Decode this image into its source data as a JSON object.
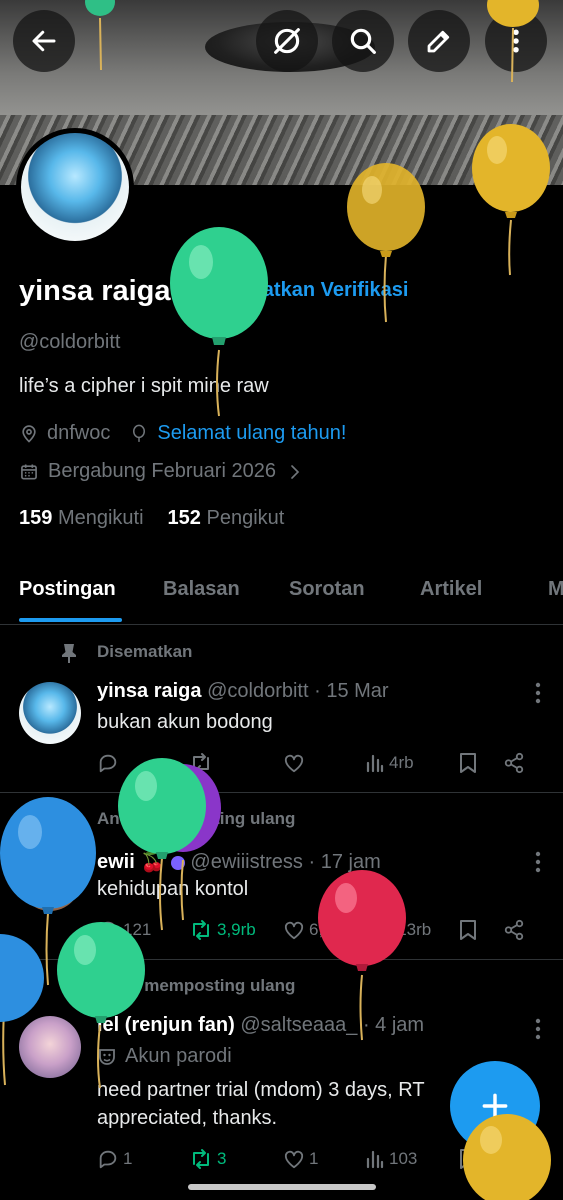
{
  "profile": {
    "name": "yinsa raiga",
    "verify_label": "Dapatkan Verifikasi",
    "handle": "@coldorbitt",
    "bio": "life’s a cipher i spit mine raw",
    "location": "dnfwoc",
    "birthday": "Selamat ulang tahun!",
    "joined": "Bergabung Februari 2026",
    "following_count": "159",
    "following_label": "Mengikuti",
    "followers_count": "152",
    "followers_label": "Pengikut"
  },
  "tabs": [
    "Postingan",
    "Balasan",
    "Sorotan",
    "Artikel",
    "M"
  ],
  "posts": [
    {
      "context": "Disematkan",
      "name": "yinsa raiga",
      "handle": "@coldorbitt",
      "time": "· 15 Mar",
      "text": "bukan akun bodong",
      "views": "4rb"
    },
    {
      "context": "Anda memposting ulang",
      "name": "ewii",
      "handle": "@ewiiistress",
      "time": "· 17 jam",
      "text": "kehidupan kontol",
      "replies": "121",
      "reposts": "3,9rb",
      "likes": "6,6rb",
      "views": "113rb"
    },
    {
      "context": "Anda memposting ulang",
      "name": "iel (renjun fan)",
      "handle": "@saltseaaa_",
      "time": "· 4 jam",
      "badge": "Akun parodi",
      "text": "need partner trial (mdom) 3 days, RT appreciated, thanks.",
      "replies": "1",
      "reposts": "3",
      "likes": "1",
      "views": "103"
    }
  ],
  "colors": {
    "accent": "#1d9bf0",
    "repost_active": "#00ba7c",
    "muted": "#71767b",
    "divider": "#2f3336"
  },
  "icons": [
    "back-arrow-icon",
    "grok-icon",
    "search-icon",
    "edit-icon",
    "more-vertical-icon",
    "verified-badge-icon",
    "location-icon",
    "balloon-icon",
    "calendar-icon",
    "chevron-right-icon",
    "pin-icon",
    "repost-icon",
    "reply-icon",
    "like-icon",
    "views-icon",
    "bookmark-icon",
    "share-icon",
    "theater-mask-icon",
    "plus-icon"
  ]
}
